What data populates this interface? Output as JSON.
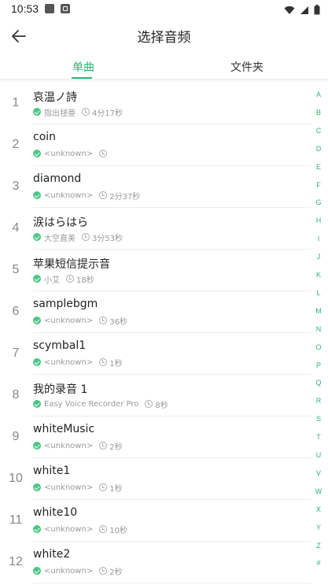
{
  "status_bar": {
    "time": "10:53"
  },
  "header": {
    "title": "选择音频",
    "back_icon": "arrow-left-icon"
  },
  "tabs": [
    {
      "label": "单曲",
      "active": true
    },
    {
      "label": "文件夹",
      "active": false
    }
  ],
  "accent_color": "#2bb673",
  "songs": [
    {
      "index": "1",
      "name": "哀温ノ詩",
      "artist": "指出毬亜",
      "duration": "4分17秒"
    },
    {
      "index": "2",
      "name": "coin",
      "artist": "<unknown>",
      "duration": ""
    },
    {
      "index": "3",
      "name": "diamond",
      "artist": "<unknown>",
      "duration": "2分37秒"
    },
    {
      "index": "4",
      "name": "涙はらはら",
      "artist": "大空直美",
      "duration": "3分53秒"
    },
    {
      "index": "5",
      "name": "苹果短信提示音",
      "artist": "小艾",
      "duration": "18秒"
    },
    {
      "index": "6",
      "name": "samplebgm",
      "artist": "<unknown>",
      "duration": "36秒"
    },
    {
      "index": "7",
      "name": "scymbal1",
      "artist": "<unknown>",
      "duration": "1秒"
    },
    {
      "index": "8",
      "name": "我的录音 1",
      "artist": "Easy Voice Recorder Pro",
      "duration": "8秒"
    },
    {
      "index": "9",
      "name": "whiteMusic",
      "artist": "<unknown>",
      "duration": "2秒"
    },
    {
      "index": "10",
      "name": "white1",
      "artist": "<unknown>",
      "duration": "1秒"
    },
    {
      "index": "11",
      "name": "white10",
      "artist": "<unknown>",
      "duration": "10秒"
    },
    {
      "index": "12",
      "name": "white2",
      "artist": "<unknown>",
      "duration": "2秒"
    }
  ],
  "index_letters": [
    "A",
    "B",
    "C",
    "D",
    "E",
    "F",
    "G",
    "H",
    "I",
    "J",
    "K",
    "L",
    "M",
    "N",
    "O",
    "P",
    "Q",
    "R",
    "S",
    "T",
    "U",
    "V",
    "W",
    "X",
    "Y",
    "Z",
    "#"
  ]
}
